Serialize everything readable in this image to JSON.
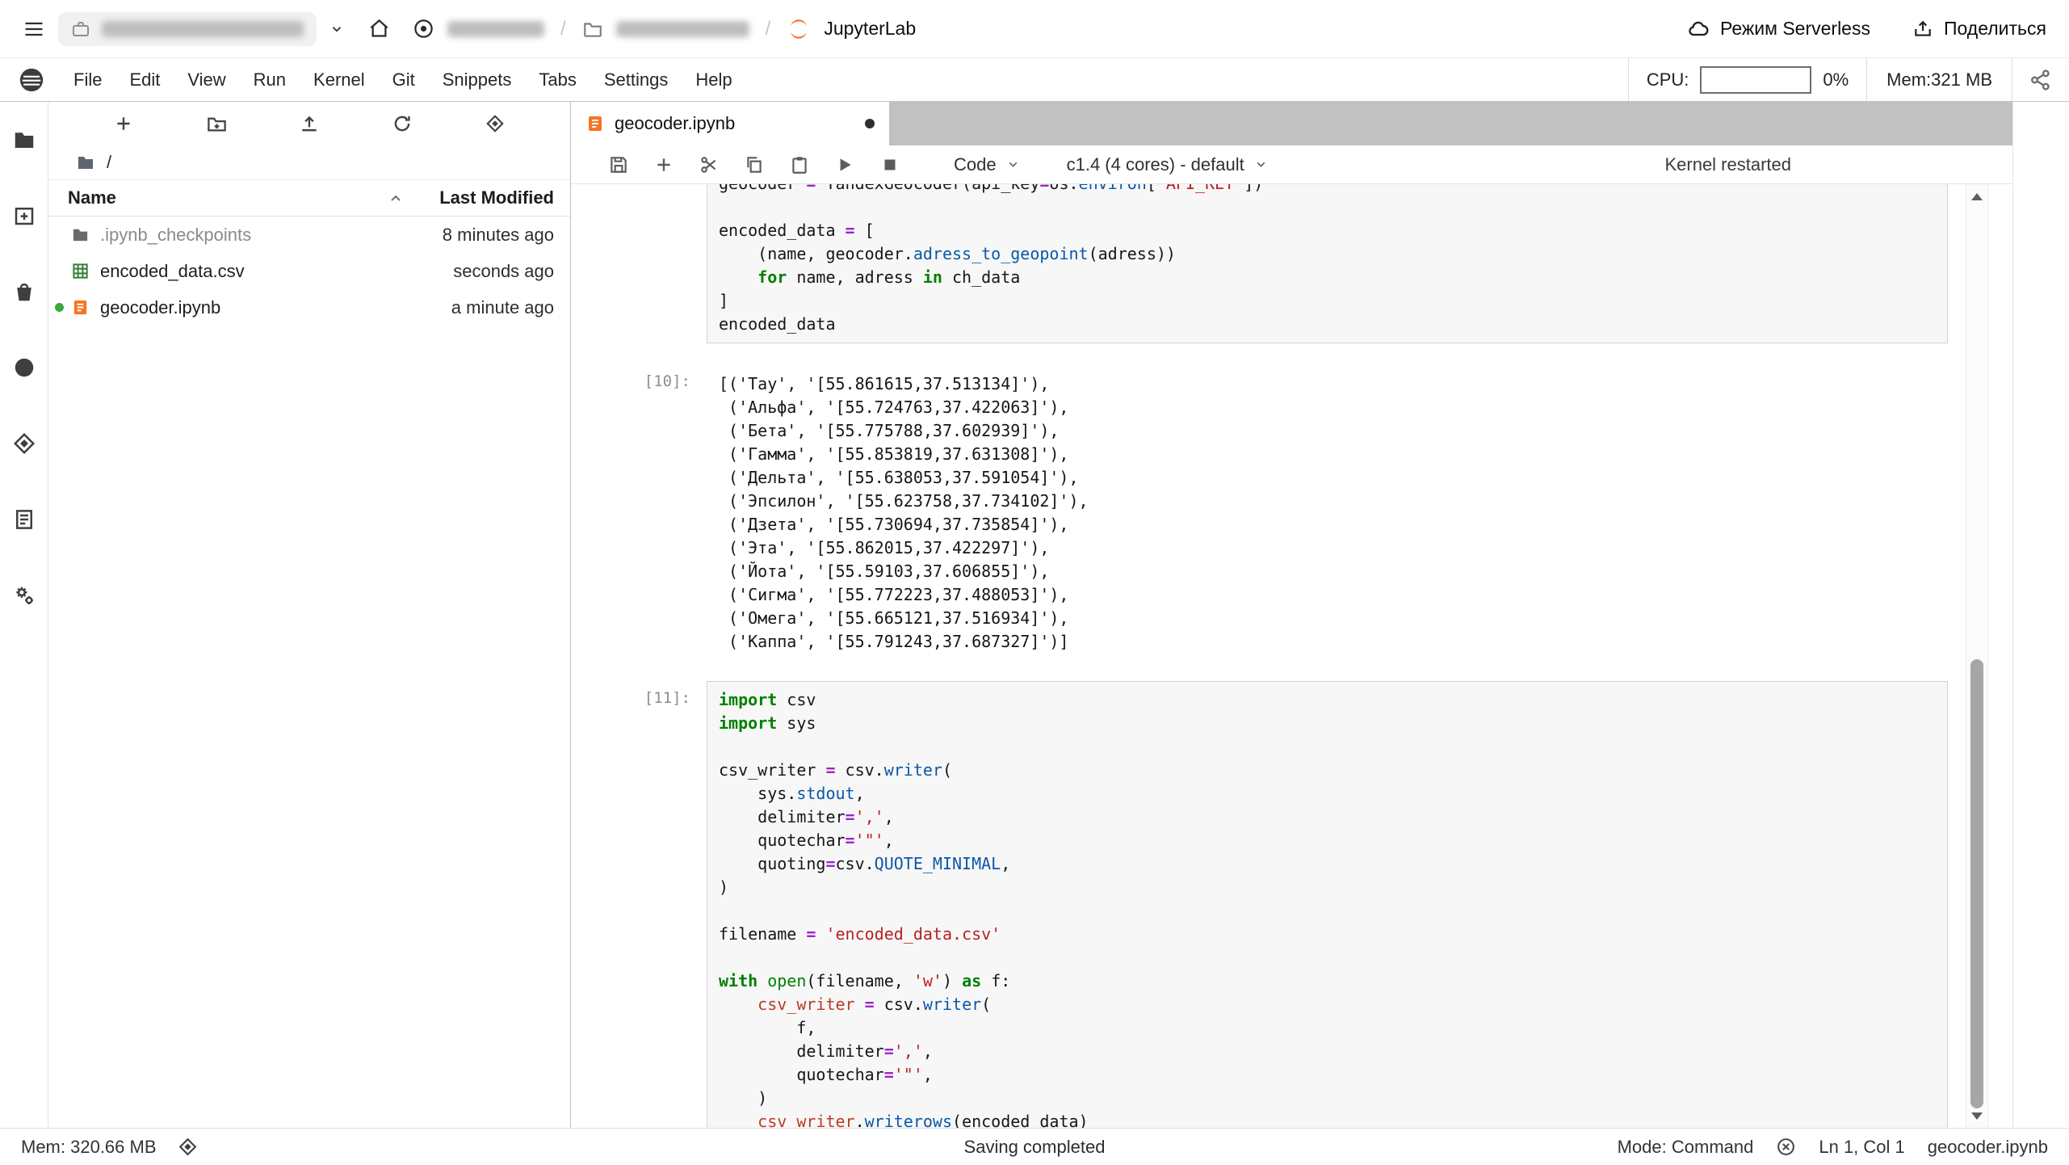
{
  "topbar": {
    "sep": "/",
    "product": "JupyterLab",
    "serverless": "Режим Serverless",
    "share": "Поделиться"
  },
  "menubar": {
    "items": [
      "File",
      "Edit",
      "View",
      "Run",
      "Kernel",
      "Git",
      "Snippets",
      "Tabs",
      "Settings",
      "Help"
    ],
    "cpu_label": "CPU:",
    "cpu_percent": "0%",
    "mem": "Mem:321 MB"
  },
  "filebrowser": {
    "breadcrumb_root": "/",
    "header_name": "Name",
    "header_modified": "Last Modified",
    "rows": [
      {
        "name": ".ipynb_checkpoints",
        "modified": "8 minutes ago"
      },
      {
        "name": "encoded_data.csv",
        "modified": "seconds ago"
      },
      {
        "name": "geocoder.ipynb",
        "modified": "a minute ago"
      }
    ]
  },
  "tab": {
    "label": "geocoder.ipynb"
  },
  "nbtoolbar": {
    "cell_type": "Code",
    "kernel": "c1.4 (4 cores) - default",
    "status": "Kernel restarted"
  },
  "cells": [
    {
      "kind": "code",
      "prompt": "",
      "clipped": true,
      "lines": [
        [
          [
            "t",
            "geocoder "
          ],
          [
            "o",
            "="
          ],
          [
            "t",
            " YandexGeocoder(api_key"
          ],
          [
            "o",
            "="
          ],
          [
            "t",
            "os."
          ],
          [
            "p",
            "environ"
          ],
          [
            "t",
            "["
          ],
          [
            "s",
            "'API_KEY'"
          ],
          [
            "t",
            "])"
          ]
        ],
        [
          [
            "t",
            ""
          ]
        ],
        [
          [
            "t",
            "encoded_data "
          ],
          [
            "o",
            "="
          ],
          [
            "t",
            " ["
          ]
        ],
        [
          [
            "t",
            "    (name, geocoder."
          ],
          [
            "p",
            "adress_to_geopoint"
          ],
          [
            "t",
            "(adress))"
          ]
        ],
        [
          [
            "t",
            "    "
          ],
          [
            "k",
            "for"
          ],
          [
            "t",
            " name, adress "
          ],
          [
            "k",
            "in"
          ],
          [
            "t",
            " ch_data"
          ]
        ],
        [
          [
            "t",
            "]"
          ]
        ],
        [
          [
            "t",
            "encoded_data"
          ]
        ]
      ]
    },
    {
      "kind": "output",
      "prompt": "[10]:",
      "lines": [
        "[('Тау', '[55.861615,37.513134]'),",
        " ('Альфа', '[55.724763,37.422063]'),",
        " ('Бета', '[55.775788,37.602939]'),",
        " ('Гамма', '[55.853819,37.631308]'),",
        " ('Дельта', '[55.638053,37.591054]'),",
        " ('Эпсилон', '[55.623758,37.734102]'),",
        " ('Дзета', '[55.730694,37.735854]'),",
        " ('Эта', '[55.862015,37.422297]'),",
        " ('Йота', '[55.59103,37.606855]'),",
        " ('Сигма', '[55.772223,37.488053]'),",
        " ('Омега', '[55.665121,37.516934]'),",
        " ('Каппа', '[55.791243,37.687327]')]"
      ]
    },
    {
      "kind": "code",
      "prompt": "[11]:",
      "clipped": false,
      "lines": [
        [
          [
            "k",
            "import"
          ],
          [
            "t",
            " csv"
          ]
        ],
        [
          [
            "k",
            "import"
          ],
          [
            "t",
            " sys"
          ]
        ],
        [
          [
            "t",
            ""
          ]
        ],
        [
          [
            "t",
            "csv_writer "
          ],
          [
            "o",
            "="
          ],
          [
            "t",
            " csv."
          ],
          [
            "p",
            "writer"
          ],
          [
            "t",
            "("
          ]
        ],
        [
          [
            "t",
            "    sys."
          ],
          [
            "p",
            "stdout"
          ],
          [
            "t",
            ","
          ]
        ],
        [
          [
            "t",
            "    delimiter"
          ],
          [
            "o",
            "="
          ],
          [
            "s",
            "','"
          ],
          [
            "t",
            ","
          ]
        ],
        [
          [
            "t",
            "    quotechar"
          ],
          [
            "o",
            "="
          ],
          [
            "s",
            "'\"'"
          ],
          [
            "t",
            ","
          ]
        ],
        [
          [
            "t",
            "    quoting"
          ],
          [
            "o",
            "="
          ],
          [
            "t",
            "csv."
          ],
          [
            "p",
            "QUOTE_MINIMAL"
          ],
          [
            "t",
            ","
          ]
        ],
        [
          [
            "t",
            ")"
          ]
        ],
        [
          [
            "t",
            ""
          ]
        ],
        [
          [
            "t",
            "filename "
          ],
          [
            "o",
            "="
          ],
          [
            "t",
            " "
          ],
          [
            "s",
            "'encoded_data.csv'"
          ]
        ],
        [
          [
            "t",
            ""
          ]
        ],
        [
          [
            "k",
            "with"
          ],
          [
            "t",
            " "
          ],
          [
            "b",
            "open"
          ],
          [
            "t",
            "(filename, "
          ],
          [
            "s",
            "'w'"
          ],
          [
            "t",
            ") "
          ],
          [
            "k",
            "as"
          ],
          [
            "t",
            " f:"
          ]
        ],
        [
          [
            "t",
            "    "
          ],
          [
            "v",
            "csv_writer"
          ],
          [
            "t",
            " "
          ],
          [
            "o",
            "="
          ],
          [
            "t",
            " csv."
          ],
          [
            "p",
            "writer"
          ],
          [
            "t",
            "("
          ]
        ],
        [
          [
            "t",
            "        f,"
          ]
        ],
        [
          [
            "t",
            "        delimiter"
          ],
          [
            "o",
            "="
          ],
          [
            "s",
            "','"
          ],
          [
            "t",
            ","
          ]
        ],
        [
          [
            "t",
            "        quotechar"
          ],
          [
            "o",
            "="
          ],
          [
            "s",
            "'\"'"
          ],
          [
            "t",
            ","
          ]
        ],
        [
          [
            "t",
            "    )"
          ]
        ],
        [
          [
            "t",
            "    "
          ],
          [
            "v",
            "csv_writer"
          ],
          [
            "t",
            "."
          ],
          [
            "p",
            "writerows"
          ],
          [
            "t",
            "(encoded_data)"
          ]
        ]
      ]
    }
  ],
  "statusbar": {
    "mem": "Mem: 320.66 MB",
    "message": "Saving completed",
    "mode": "Mode: Command",
    "position": "Ln 1, Col 1",
    "filename": "geocoder.ipynb"
  }
}
